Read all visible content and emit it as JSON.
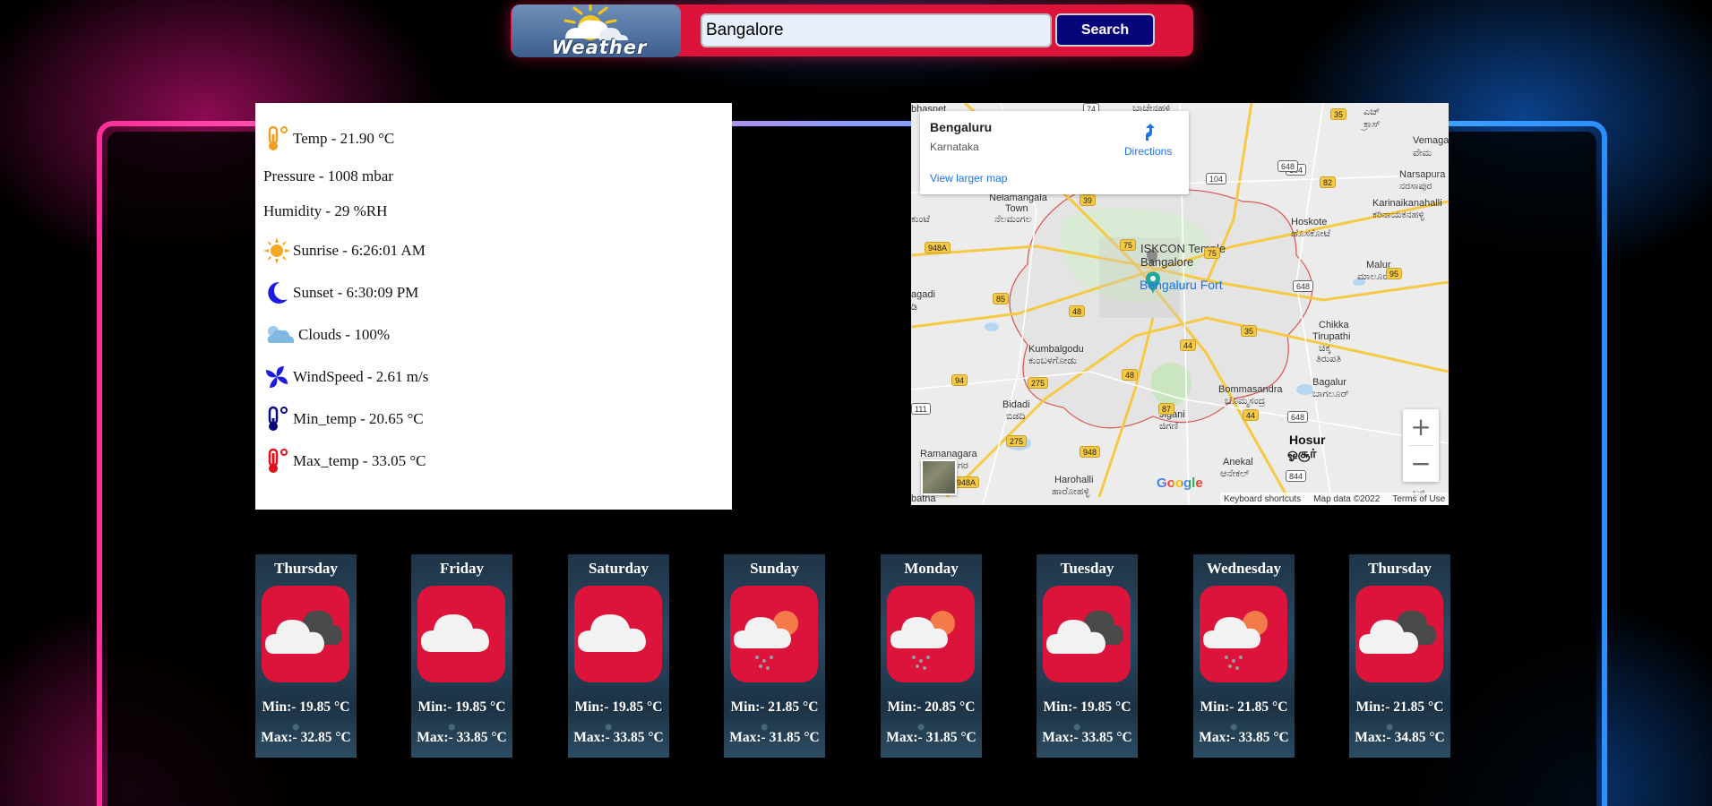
{
  "header": {
    "logo_text": "Weather",
    "search_value": "Bangalore",
    "search_label": "Search"
  },
  "details": {
    "temp": "Temp - 21.90 °C",
    "pressure": "Pressure - 1008 mbar",
    "humidity": "Humidity - 29 %RH",
    "sunrise": "Sunrise - 6:26:01 AM",
    "sunset": "Sunset - 6:30:09 PM",
    "clouds": "Clouds - 100%",
    "windspeed": "WindSpeed - 2.61 m/s",
    "min_temp": "Min_temp - 20.65 °C",
    "max_temp": "Max_temp - 33.05 °C"
  },
  "map": {
    "place": "Bengaluru",
    "region": "Karnataka",
    "directions": "Directions",
    "view_larger": "View larger map",
    "zoom_in": "+",
    "zoom_out": "−",
    "google": "Google",
    "shortcuts": "Keyboard shortcuts",
    "map_data": "Map data ©2022",
    "terms": "Terms of Use",
    "labels": {
      "nelamangala": "Nelamangala",
      "town": "Town",
      "nelamangala_kn": "ನೆಲಮಂಗಲ",
      "kunte": "ಕುಂಟೆ",
      "iskcon": "ISKCON Temple",
      "iskcon2": "Bangalore",
      "fort": "Bengaluru Fort",
      "hoskote": "Hoskote",
      "hoskote_kn": "ಹೊಸಕೋಟೆ",
      "malur": "Malur",
      "malur_kn": "ಮಾಲೂರು",
      "kumbalgodu": "Kumbalgodu",
      "kumbalgodu_kn": "ಕುಂಬಳಗೋಡು",
      "chikka": "Chikka",
      "tirupathi": "Tirupathi",
      "tirupathi_kn1": "ಚಿಕ್ಕ",
      "tirupathi_kn2": "ತಿರುಪತಿ",
      "bommasandra": "Bommasandra",
      "bommasandra_kn": "ಬೊಮ್ಮಸಂದ್ರ",
      "bagalur": "Bagalur",
      "bagalur_kn": "ಬಾಗಲೂರ್",
      "bidadi": "Bidadi",
      "bidadi_kn": "ಬಿಡದಿ",
      "jigani": "Jigani",
      "jigani_kn": "ಜಿಗಣಿ",
      "hosur": "Hosur",
      "hosur_ta": "ஓசூர்",
      "ramanagara": "Ramanagara",
      "ramanagara_kn": "ಗರ",
      "anekal": "Anekal",
      "anekal_kn": "ಆನೇಕಲ್",
      "harohalli": "Harohalli",
      "harohalli_kn": "ಹಾರೋಹಳ್ಳಿ",
      "vemaga": "Vemaga",
      "vemaga_kn": "ವೇಮ",
      "narsapura": "Narsapura",
      "narsapura_kn": "ನರಸಾಪುರ",
      "karinaikanahalli": "Karinaikanahalli",
      "karinaikanahalli_kn": "ಕರಿನಾಯಕನಹಳ್ಳಿ",
      "agadi": "agadi",
      "agadi_kn": "ಡಿ",
      "bhasnet": "bhasnet",
      "batna": "batna",
      "topkn1": "ಬಾಚೇನಹಳ್ಳಿ",
      "topkn2": "ಎಚ್",
      "topkn3": "ಕ್ರಾಸ್",
      "bottomkn": "ಬಳ್ಳಿ"
    },
    "shields": [
      "74",
      "35",
      "104",
      "104",
      "648",
      "82",
      "39",
      "75",
      "948A",
      "75",
      "648",
      "95",
      "85",
      "48",
      "35",
      "44",
      "94",
      "275",
      "48",
      "87",
      "44",
      "111",
      "275",
      "948",
      "648",
      "948A",
      "844"
    ]
  },
  "forecast": [
    {
      "day": "Thursday",
      "min": "Min:- 19.85 °C",
      "max": "Max:- 32.85 °C",
      "icon": "cloudy-icon"
    },
    {
      "day": "Friday",
      "min": "Min:- 19.85 °C",
      "max": "Max:- 33.85 °C",
      "icon": "cloud-icon"
    },
    {
      "day": "Saturday",
      "min": "Min:- 19.85 °C",
      "max": "Max:- 33.85 °C",
      "icon": "cloud-icon"
    },
    {
      "day": "Sunday",
      "min": "Min:- 21.85 °C",
      "max": "Max:- 31.85 °C",
      "icon": "sun-rain-icon"
    },
    {
      "day": "Monday",
      "min": "Min:- 20.85 °C",
      "max": "Max:- 31.85 °C",
      "icon": "sun-rain-icon"
    },
    {
      "day": "Tuesday",
      "min": "Min:- 19.85 °C",
      "max": "Max:- 33.85 °C",
      "icon": "cloudy-icon"
    },
    {
      "day": "Wednesday",
      "min": "Min:- 21.85 °C",
      "max": "Max:- 33.85 °C",
      "icon": "sun-rain-icon"
    },
    {
      "day": "Thursday",
      "min": "Min:- 21.85 °C",
      "max": "Max:- 34.85 °C",
      "icon": "cloudy-icon"
    }
  ],
  "colors": {
    "accent": "#dc143c",
    "button": "#06067a",
    "frame_left": "#ff2d9a",
    "frame_right": "#2a8fff"
  }
}
